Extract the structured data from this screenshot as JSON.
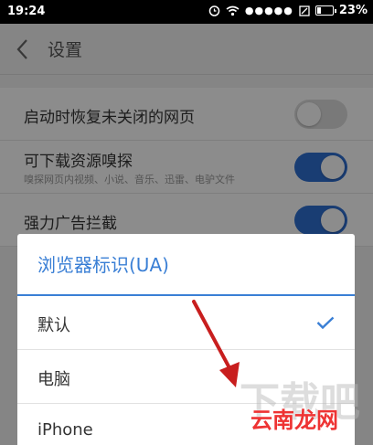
{
  "status_bar": {
    "time": "19:24",
    "signal_dots": "●●●●●",
    "battery": "23%"
  },
  "header": {
    "title": "设置"
  },
  "settings": [
    {
      "label": "启动时恢复未关闭的网页",
      "sub": "",
      "enabled": false
    },
    {
      "label": "可下载资源嗅探",
      "sub": "嗅探网页内视频、小说、音乐、迅雷、电驴文件",
      "enabled": true
    },
    {
      "label": "强力广告拦截",
      "sub": "",
      "enabled": true
    }
  ],
  "dialog": {
    "title": "浏览器标识(UA)",
    "options": [
      {
        "label": "默认",
        "selected": true
      },
      {
        "label": "电脑",
        "selected": false
      },
      {
        "label": "iPhone",
        "selected": false
      }
    ]
  },
  "colors": {
    "accent": "#3a7fd5",
    "toggle_on": "#2f6fd2",
    "annotation_arrow": "#c81e1e"
  },
  "watermark": {
    "text": "云南龙网"
  }
}
